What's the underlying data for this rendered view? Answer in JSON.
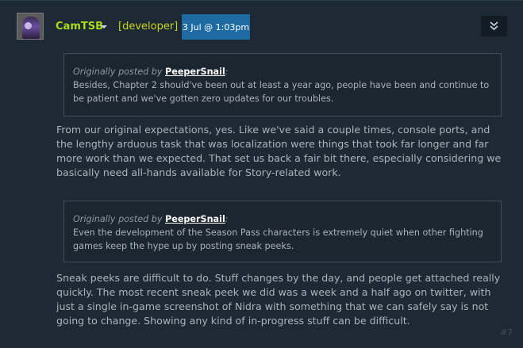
{
  "post": {
    "author": "CamTSB",
    "role": "[developer]",
    "timestamp": "3 Jul @ 1:03pm",
    "number": "#7"
  },
  "quotes": [
    {
      "prefix": "Originally posted by ",
      "author": "PeeperSnail",
      "suffix": ":",
      "text": "Besides, Chapter 2 should've been out at least a year ago, people have been and continue to be patient and we've gotten zero updates for our troubles."
    },
    {
      "prefix": "Originally posted by ",
      "author": "PeeperSnail",
      "suffix": ":",
      "text": "Even the development of the Season Pass characters is extremely quiet when other fighting games keep the hype up by posting sneak peeks."
    }
  ],
  "replies": [
    "From our original expectations, yes. Like we've said a couple times, console ports, and the lengthy arduous task that was localization were things that took far longer and far more work than we expected. That set us back a fair bit there, especially considering we basically need all-hands available for Story-related work.",
    "Sneak peeks are difficult to do. Stuff changes by the day, and people get attached really quickly. The most recent sneak peek we did was a week and a half ago on twitter, with just a single in-game screenshot of Nidra with something that we can safely say is not going to change. Showing any kind of in-progress stuff can be difficult."
  ]
}
